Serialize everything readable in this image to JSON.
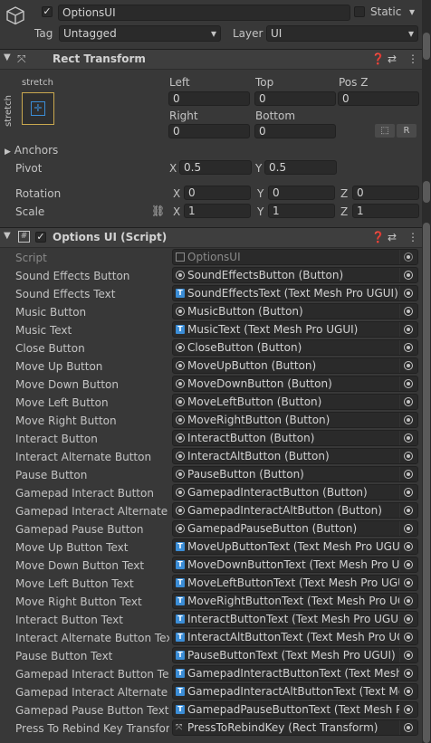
{
  "header": {
    "object_name": "OptionsUI",
    "static_label": "Static",
    "tag_label": "Tag",
    "tag_value": "Untagged",
    "layer_label": "Layer",
    "layer_value": "UI"
  },
  "rect_transform": {
    "title": "Rect Transform",
    "anchor_preset_top": "stretch",
    "anchor_preset_side": "stretch",
    "left_label": "Left",
    "left": "0",
    "top_label": "Top",
    "top": "0",
    "posz_label": "Pos Z",
    "posz": "0",
    "right_label": "Right",
    "right": "0",
    "bottom_label": "Bottom",
    "bottom": "0",
    "r_button": "R",
    "anchors_label": "Anchors",
    "pivot_label": "Pivot",
    "pivot_x": "0.5",
    "pivot_y": "0.5",
    "rotation_label": "Rotation",
    "rot_x": "0",
    "rot_y": "0",
    "rot_z": "0",
    "scale_label": "Scale",
    "scale_x": "1",
    "scale_y": "1",
    "scale_z": "1",
    "x": "X",
    "y": "Y",
    "z": "Z"
  },
  "script_component": {
    "title": "Options UI (Script)",
    "script_label": "Script",
    "script_value": "OptionsUI",
    "fields": [
      {
        "label": "Sound Effects Button",
        "value": "SoundEffectsButton (Button)",
        "icon": "button-icon"
      },
      {
        "label": "Sound Effects Text",
        "value": "SoundEffectsText (Text Mesh Pro UGUI)",
        "icon": "text-icon"
      },
      {
        "label": "Music Button",
        "value": "MusicButton (Button)",
        "icon": "button-icon"
      },
      {
        "label": "Music Text",
        "value": "MusicText (Text Mesh Pro UGUI)",
        "icon": "text-icon"
      },
      {
        "label": "Close Button",
        "value": "CloseButton (Button)",
        "icon": "button-icon"
      },
      {
        "label": "Move Up Button",
        "value": "MoveUpButton (Button)",
        "icon": "button-icon"
      },
      {
        "label": "Move Down Button",
        "value": "MoveDownButton (Button)",
        "icon": "button-icon"
      },
      {
        "label": "Move Left Button",
        "value": "MoveLeftButton (Button)",
        "icon": "button-icon"
      },
      {
        "label": "Move Right Button",
        "value": "MoveRightButton (Button)",
        "icon": "button-icon"
      },
      {
        "label": "Interact Button",
        "value": "InteractButton (Button)",
        "icon": "button-icon"
      },
      {
        "label": "Interact Alternate Button",
        "value": "InteractAltButton (Button)",
        "icon": "button-icon"
      },
      {
        "label": "Pause Button",
        "value": "PauseButton (Button)",
        "icon": "button-icon"
      },
      {
        "label": "Gamepad Interact Button",
        "value": "GamepadInteractButton (Button)",
        "icon": "button-icon"
      },
      {
        "label": "Gamepad Interact Alternate Bu",
        "value": "GamepadInteractAltButton (Button)",
        "icon": "button-icon"
      },
      {
        "label": "Gamepad Pause Button",
        "value": "GamepadPauseButton (Button)",
        "icon": "button-icon"
      },
      {
        "label": "Move Up Button Text",
        "value": "MoveUpButtonText (Text Mesh Pro UGUI)",
        "icon": "text-icon"
      },
      {
        "label": "Move Down Button Text",
        "value": "MoveDownButtonText (Text Mesh Pro UG",
        "icon": "text-icon"
      },
      {
        "label": "Move Left Button Text",
        "value": "MoveLeftButtonText (Text Mesh Pro UGU",
        "icon": "text-icon"
      },
      {
        "label": "Move Right Button Text",
        "value": "MoveRightButtonText (Text Mesh Pro UG",
        "icon": "text-icon"
      },
      {
        "label": "Interact Button Text",
        "value": "InteractButtonText (Text Mesh Pro UGUI)",
        "icon": "text-icon"
      },
      {
        "label": "Interact Alternate Button Text",
        "value": "InteractAltButtonText (Text Mesh Pro UG",
        "icon": "text-icon"
      },
      {
        "label": "Pause Button Text",
        "value": "PauseButtonText (Text Mesh Pro UGUI)",
        "icon": "text-icon"
      },
      {
        "label": "Gamepad Interact Button Text",
        "value": "GamepadInteractButtonText (Text Mesh P",
        "icon": "text-icon"
      },
      {
        "label": "Gamepad Interact Alternate B",
        "value": "GamepadInteractAltButtonText (Text Mes",
        "icon": "text-icon"
      },
      {
        "label": "Gamepad Pause Button Text",
        "value": "GamepadPauseButtonText (Text Mesh Pro",
        "icon": "text-icon"
      },
      {
        "label": "Press To Rebind Key Transfor",
        "value": "PressToRebindKey (Rect Transform)",
        "icon": "rect-transform-icon"
      }
    ]
  },
  "colors": {
    "background": "#383838",
    "field": "#2a2a2a",
    "text_icon": "#3b8dd6"
  }
}
